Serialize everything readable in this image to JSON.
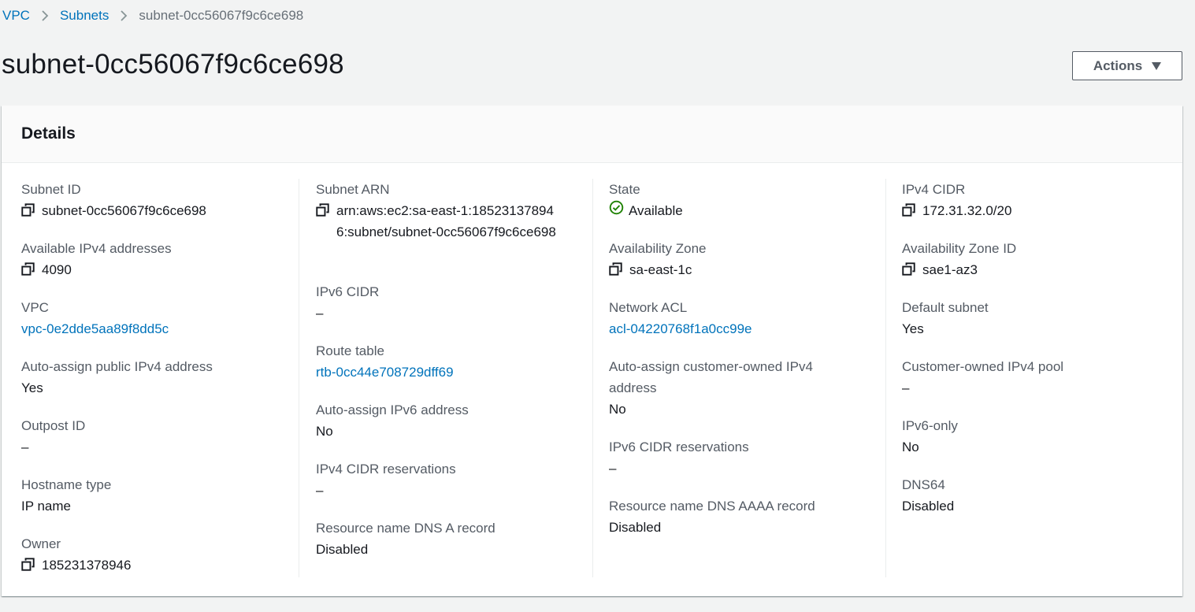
{
  "breadcrumb": {
    "items": [
      "VPC",
      "Subnets"
    ],
    "current": "subnet-0cc56067f9c6ce698"
  },
  "page_title": "subnet-0cc56067f9c6ce698",
  "actions_label": "Actions",
  "details": {
    "title": "Details",
    "subnet_id": {
      "label": "Subnet ID",
      "value": "subnet-0cc56067f9c6ce698"
    },
    "available_ipv4": {
      "label": "Available IPv4 addresses",
      "value": "4090"
    },
    "vpc": {
      "label": "VPC",
      "value": "vpc-0e2dde5aa89f8dd5c"
    },
    "auto_assign_public_ipv4": {
      "label": "Auto-assign public IPv4 address",
      "value": "Yes"
    },
    "outpost_id": {
      "label": "Outpost ID",
      "value": "–"
    },
    "hostname_type": {
      "label": "Hostname type",
      "value": "IP name"
    },
    "owner": {
      "label": "Owner",
      "value": "185231378946"
    },
    "subnet_arn": {
      "label": "Subnet ARN",
      "value": "arn:aws:ec2:sa-east-1:185231378946:subnet/subnet-0cc56067f9c6ce698"
    },
    "ipv6_cidr": {
      "label": "IPv6 CIDR",
      "value": "–"
    },
    "route_table": {
      "label": "Route table",
      "value": "rtb-0cc44e708729dff69"
    },
    "auto_assign_ipv6": {
      "label": "Auto-assign IPv6 address",
      "value": "No"
    },
    "ipv4_cidr_reservations": {
      "label": "IPv4 CIDR reservations",
      "value": "–"
    },
    "rn_dns_a": {
      "label": "Resource name DNS A record",
      "value": "Disabled"
    },
    "state": {
      "label": "State",
      "value": "Available",
      "color": "#1d8102"
    },
    "availability_zone": {
      "label": "Availability Zone",
      "value": "sa-east-1c"
    },
    "network_acl": {
      "label": "Network ACL",
      "value": "acl-04220768f1a0cc99e"
    },
    "auto_assign_customer_owned": {
      "label": "Auto-assign customer-owned IPv4 address",
      "value": "No"
    },
    "ipv6_cidr_reservations": {
      "label": "IPv6 CIDR reservations",
      "value": "–"
    },
    "rn_dns_aaaa": {
      "label": "Resource name DNS AAAA record",
      "value": "Disabled"
    },
    "ipv4_cidr": {
      "label": "IPv4 CIDR",
      "value": "172.31.32.0/20"
    },
    "availability_zone_id": {
      "label": "Availability Zone ID",
      "value": "sae1-az3"
    },
    "default_subnet": {
      "label": "Default subnet",
      "value": "Yes"
    },
    "customer_owned_pool": {
      "label": "Customer-owned IPv4 pool",
      "value": "–"
    },
    "ipv6_only": {
      "label": "IPv6-only",
      "value": "No"
    },
    "dns64": {
      "label": "DNS64",
      "value": "Disabled"
    }
  },
  "colors": {
    "link": "#0073bb",
    "success": "#1d8102",
    "background": "#f2f3f3",
    "label": "#545b64"
  },
  "icons": [
    "chevron-right-icon",
    "copy-icon",
    "status-success-icon",
    "caret-down-icon"
  ]
}
